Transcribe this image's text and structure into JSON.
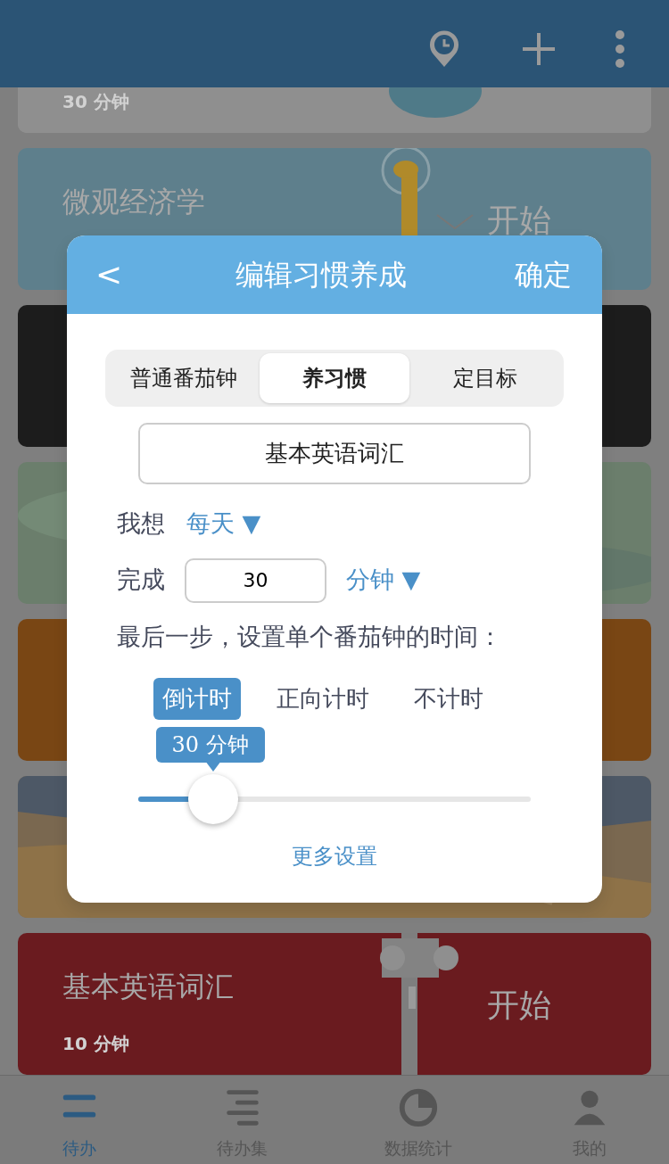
{
  "cards": [
    {
      "kind": "picture",
      "subtitle": "30 分钟"
    },
    {
      "kind": "picture",
      "title": "微观经济学",
      "action": "开始"
    },
    {
      "kind": "plain"
    },
    {
      "kind": "picture"
    },
    {
      "kind": "plain"
    },
    {
      "kind": "picture"
    },
    {
      "kind": "picture",
      "title": "基本英语词汇",
      "subtitle": "10 分钟",
      "action": "开始"
    }
  ],
  "dialog": {
    "back": "<",
    "title": "编辑习惯养成",
    "confirm": "确定",
    "tabs": [
      {
        "label": "普通番茄钟",
        "selected": false
      },
      {
        "label": "养习惯",
        "selected": true
      },
      {
        "label": "定目标",
        "selected": false
      }
    ],
    "name_value": "基本英语词汇",
    "frequency": {
      "label": "我想",
      "value": "每天 ▼"
    },
    "amount": {
      "label": "完成",
      "value": "30",
      "unit": "分钟 ▼"
    },
    "instruction": "最后一步，设置单个番茄钟的时间：",
    "timer_modes": [
      {
        "label": "倒计时",
        "selected": true
      },
      {
        "label": "正向计时",
        "selected": false
      },
      {
        "label": "不计时",
        "selected": false
      }
    ],
    "slider": {
      "reading": "30 分钟",
      "level": 0.19
    },
    "more_link": "更多设置"
  },
  "bottom_nav": [
    {
      "label": "待办",
      "selected": true
    },
    {
      "label": "待办集",
      "selected": false
    },
    {
      "label": "数据统计",
      "selected": false
    },
    {
      "label": "我的",
      "selected": false
    }
  ]
}
